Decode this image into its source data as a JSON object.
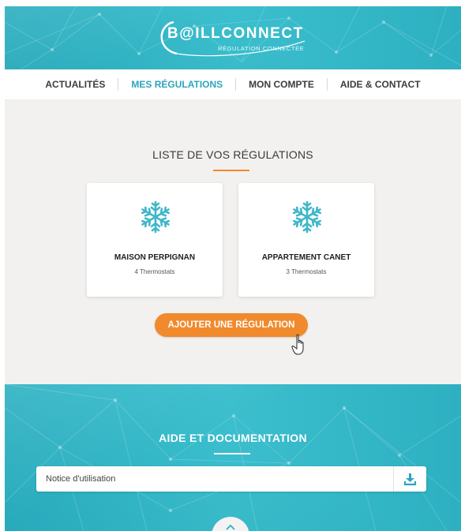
{
  "header": {
    "logo_title": "B@ILLCONNECT",
    "logo_subtitle": "RÉGULATION CONNECTÉE"
  },
  "nav": {
    "items": [
      {
        "label": "ACTUALITÉS",
        "active": false
      },
      {
        "label": "MES RÉGULATIONS",
        "active": true
      },
      {
        "label": "MON COMPTE",
        "active": false
      },
      {
        "label": "AIDE & CONTACT",
        "active": false
      }
    ]
  },
  "regulations": {
    "title": "LISTE DE VOS RÉGULATIONS",
    "cards": [
      {
        "name": "MAISON PERPIGNAN",
        "count": "4 Thermostats",
        "icon": "snowflake-icon"
      },
      {
        "name": "APPARTEMENT CANET",
        "count": "3 Thermostats",
        "icon": "snowflake-icon"
      }
    ],
    "add_button": "AJOUTER UNE RÉGULATION"
  },
  "help": {
    "title": "AIDE ET DOCUMENTATION",
    "notice_value": "Notice d'utilisation",
    "download_icon": "download-icon",
    "up_icon": "chevron-up-icon"
  },
  "colors": {
    "accent": "#2aa5bd",
    "orange": "#f08a2c",
    "teal_bg": "#3bbecd",
    "snowflake": "#3fb7c9"
  }
}
